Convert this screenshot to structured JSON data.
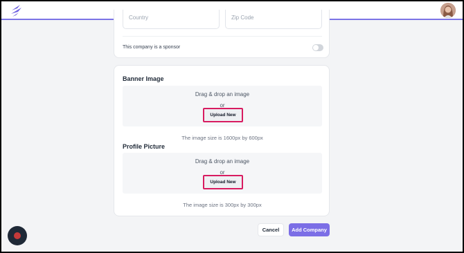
{
  "colors": {
    "accent": "#7b73e6",
    "highlight": "#d81b60",
    "record": "#c53a3a"
  },
  "header": {
    "logo_icon": "brand-logo-icon",
    "avatar": "user-avatar"
  },
  "address": {
    "country_placeholder": "Country",
    "zip_placeholder": "Zip Code"
  },
  "sponsor": {
    "label": "This company is a sponsor",
    "enabled": false
  },
  "banner": {
    "title": "Banner Image",
    "drag_text": "Drag & drop an image",
    "or_text": "or",
    "upload_label": "Upload New",
    "size_note": "The image size is 1600px by 600px"
  },
  "profile": {
    "title": "Profile Picture",
    "drag_text": "Drag & drop an image",
    "or_text": "or",
    "upload_label": "Upload New",
    "size_note": "The image size is 300px by 300px"
  },
  "actions": {
    "cancel_label": "Cancel",
    "submit_label": "Add Company"
  },
  "recorder": {
    "icon": "record-icon"
  }
}
